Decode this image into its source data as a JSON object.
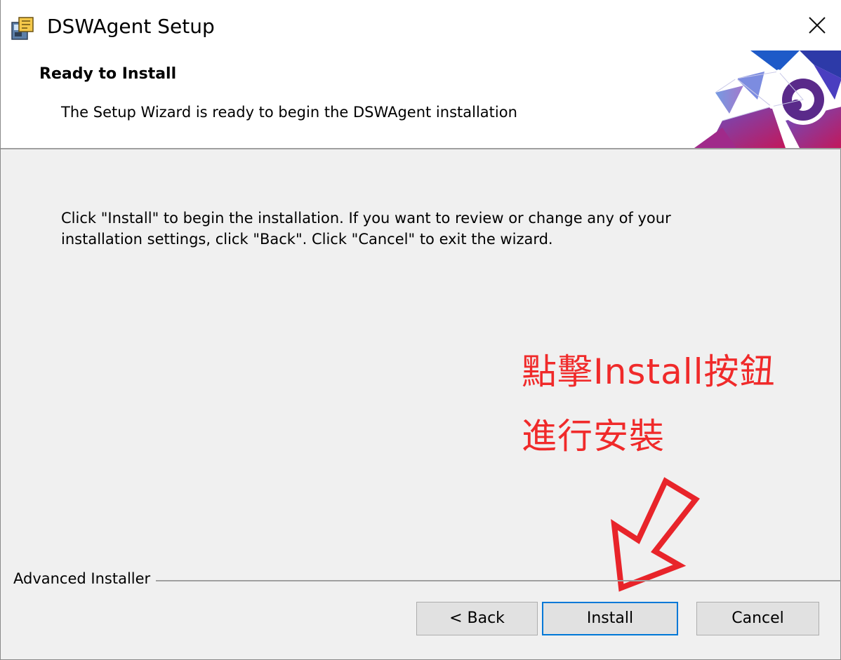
{
  "window": {
    "title": "DSWAgent Setup",
    "close_icon": "close-icon"
  },
  "banner": {
    "title": "Ready to Install",
    "subtitle": "The Setup Wizard is ready to begin the DSWAgent installation"
  },
  "body": {
    "text": "Click \"Install\" to begin the installation.  If you want to review or change any of your\ninstallation settings, click \"Back\".  Click \"Cancel\" to exit the wizard."
  },
  "annotation": {
    "line1": "點擊Install按鈕",
    "line2": "進行安裝",
    "color": "#f02a2a"
  },
  "footer": {
    "label": "Advanced Installer"
  },
  "buttons": {
    "back": "< Back",
    "install": "Install",
    "cancel": "Cancel"
  },
  "colors": {
    "focus_border": "#0078d7",
    "dialog_bg": "#f0f0f0"
  }
}
